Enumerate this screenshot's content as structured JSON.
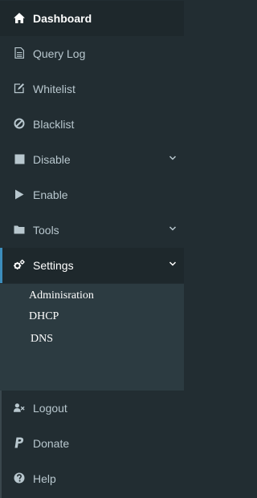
{
  "menu": {
    "items": [
      {
        "label": "Dashboard",
        "icon": "home-icon"
      },
      {
        "label": "Query Log",
        "icon": "file-text-icon"
      },
      {
        "label": "Whitelist",
        "icon": "edit-icon"
      },
      {
        "label": "Blacklist",
        "icon": "ban-icon"
      },
      {
        "label": "Disable",
        "icon": "stop-icon"
      },
      {
        "label": "Enable",
        "icon": "play-icon"
      },
      {
        "label": "Tools",
        "icon": "folder-icon"
      },
      {
        "label": "Settings",
        "icon": "cogs-icon"
      }
    ],
    "settings_submenu": [
      {
        "label": "Adminisration"
      },
      {
        "label": "DHCP"
      },
      {
        "label": "DNS"
      }
    ],
    "bottom": [
      {
        "label": "Logout",
        "icon": "user-times-icon"
      },
      {
        "label": "Donate",
        "icon": "paypal-icon"
      },
      {
        "label": "Help",
        "icon": "question-circle-icon"
      }
    ]
  },
  "colors": {
    "sidebar_bg": "#222d32",
    "active_bg": "#1e282c",
    "submenu_bg": "#2c3b41",
    "accent": "#3c8dbc",
    "text": "#b8c7ce",
    "text_active": "#ffffff"
  }
}
